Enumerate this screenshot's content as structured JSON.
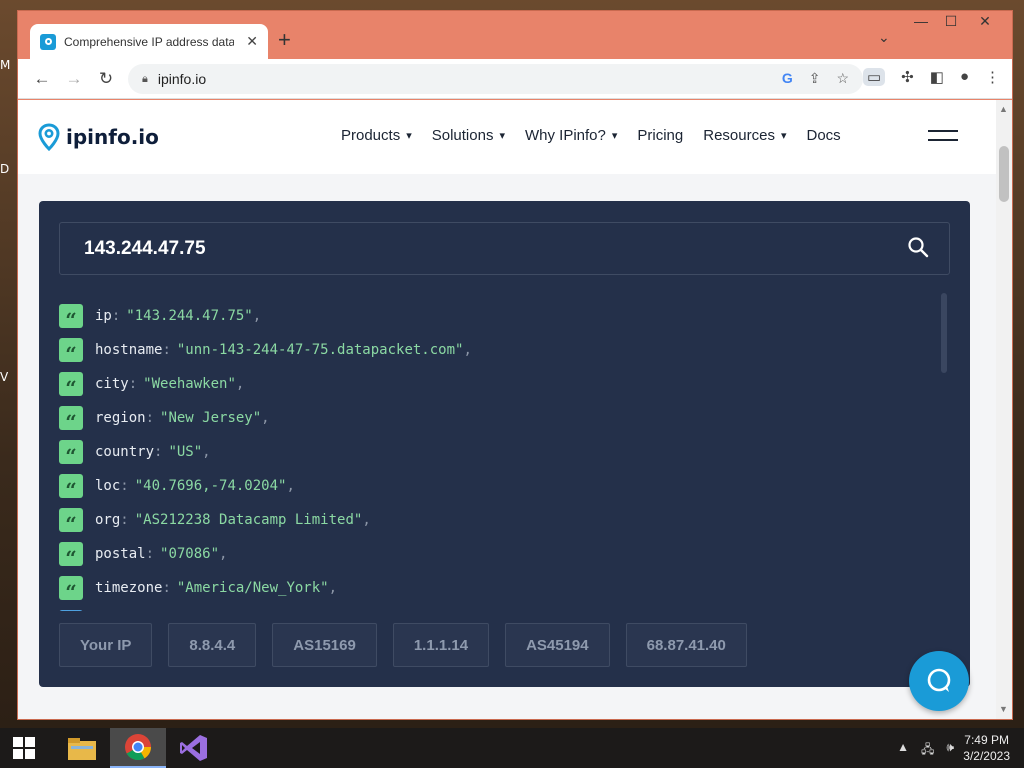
{
  "desktop": {
    "labels": [
      "M",
      "D",
      "V"
    ]
  },
  "browser": {
    "tab_title": "Comprehensive IP address data, I",
    "tab_close": "✕",
    "new_tab": "+",
    "url": "ipinfo.io",
    "window_controls": {
      "minimize": "—",
      "maximize": "☐",
      "close": "✕"
    }
  },
  "site": {
    "logo_text": "ipinfo.io",
    "nav": [
      {
        "label": "Products",
        "has_dropdown": true
      },
      {
        "label": "Solutions",
        "has_dropdown": true
      },
      {
        "label": "Why IPinfo?",
        "has_dropdown": true
      },
      {
        "label": "Pricing",
        "has_dropdown": false
      },
      {
        "label": "Resources",
        "has_dropdown": true
      },
      {
        "label": "Docs",
        "has_dropdown": false
      }
    ]
  },
  "lookup": {
    "search_value": "143.244.47.75",
    "fields": [
      {
        "key": "ip",
        "value": "\"143.244.47.75\""
      },
      {
        "key": "hostname",
        "value": "\"unn-143-244-47-75.datapacket.com\""
      },
      {
        "key": "city",
        "value": "\"Weehawken\""
      },
      {
        "key": "region",
        "value": "\"New Jersey\""
      },
      {
        "key": "country",
        "value": "\"US\""
      },
      {
        "key": "loc",
        "value": "\"40.7696,-74.0204\""
      },
      {
        "key": "org",
        "value": "\"AS212238 Datacamp Limited\""
      },
      {
        "key": "postal",
        "value": "\"07086\""
      },
      {
        "key": "timezone",
        "value": "\"America/New_York\""
      }
    ],
    "colon": ":",
    "comma": ",",
    "quick_buttons": [
      "Your IP",
      "8.8.4.4",
      "AS15169",
      "1.1.1.14",
      "AS45194",
      "68.87.41.40"
    ]
  },
  "taskbar": {
    "time": "7:49 PM",
    "date": "3/2/2023"
  },
  "colors": {
    "brand": "#1a9bd7",
    "card_bg": "#24304a",
    "json_value": "#8bd9a3",
    "badge": "#6dd48a",
    "titlebar": "#e8836a"
  }
}
